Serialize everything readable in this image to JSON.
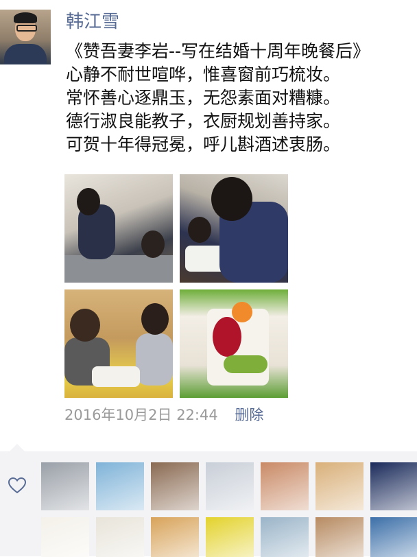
{
  "post": {
    "username": "韩江雪",
    "lines": [
      "《赞吾妻李岩--写在结婚十周年晚餐后》",
      "心静不耐世喧哗，惟喜窗前巧梳妆。",
      "常怀善心逐鼎玉，无怨素面对糟糠。",
      "德行淑良能教子，衣厨规划善持家。",
      "可贺十年得冠冕，呼儿斟酒述衷肠。"
    ],
    "timestamp": "2016年10月2日 22:44",
    "delete_label": "删除"
  },
  "photos": [
    {
      "name": "kitchen-cooking-photo"
    },
    {
      "name": "kitchen-stove-photo"
    },
    {
      "name": "dinner-toast-photo"
    },
    {
      "name": "fruit-cake-photo"
    }
  ],
  "likes": {
    "icon": "heart-icon",
    "colors": {
      "link": "#576b95",
      "time": "#9a9a9a",
      "panel": "#f3f3f5"
    },
    "avatars": [
      {
        "name": "liker-avatar-1",
        "color": "#9aa0a8"
      },
      {
        "name": "liker-avatar-2",
        "color": "#7fb3d8"
      },
      {
        "name": "liker-avatar-3",
        "color": "#8a6a52"
      },
      {
        "name": "liker-avatar-4",
        "color": "#c9cfd8"
      },
      {
        "name": "liker-avatar-5",
        "color": "#c98a66"
      },
      {
        "name": "liker-avatar-6",
        "color": "#d9b07a"
      },
      {
        "name": "liker-avatar-7",
        "color": "#1a2a5a"
      },
      {
        "name": "liker-avatar-8",
        "color": "#f4f1ea"
      },
      {
        "name": "liker-avatar-9",
        "color": "#e8e4da"
      },
      {
        "name": "liker-avatar-10",
        "color": "#d8a35a"
      },
      {
        "name": "liker-avatar-11",
        "color": "#e3d22c"
      },
      {
        "name": "liker-avatar-12",
        "color": "#9ab4c8"
      },
      {
        "name": "liker-avatar-13",
        "color": "#b78b62"
      },
      {
        "name": "liker-avatar-14",
        "color": "#3c6fa8"
      }
    ]
  }
}
